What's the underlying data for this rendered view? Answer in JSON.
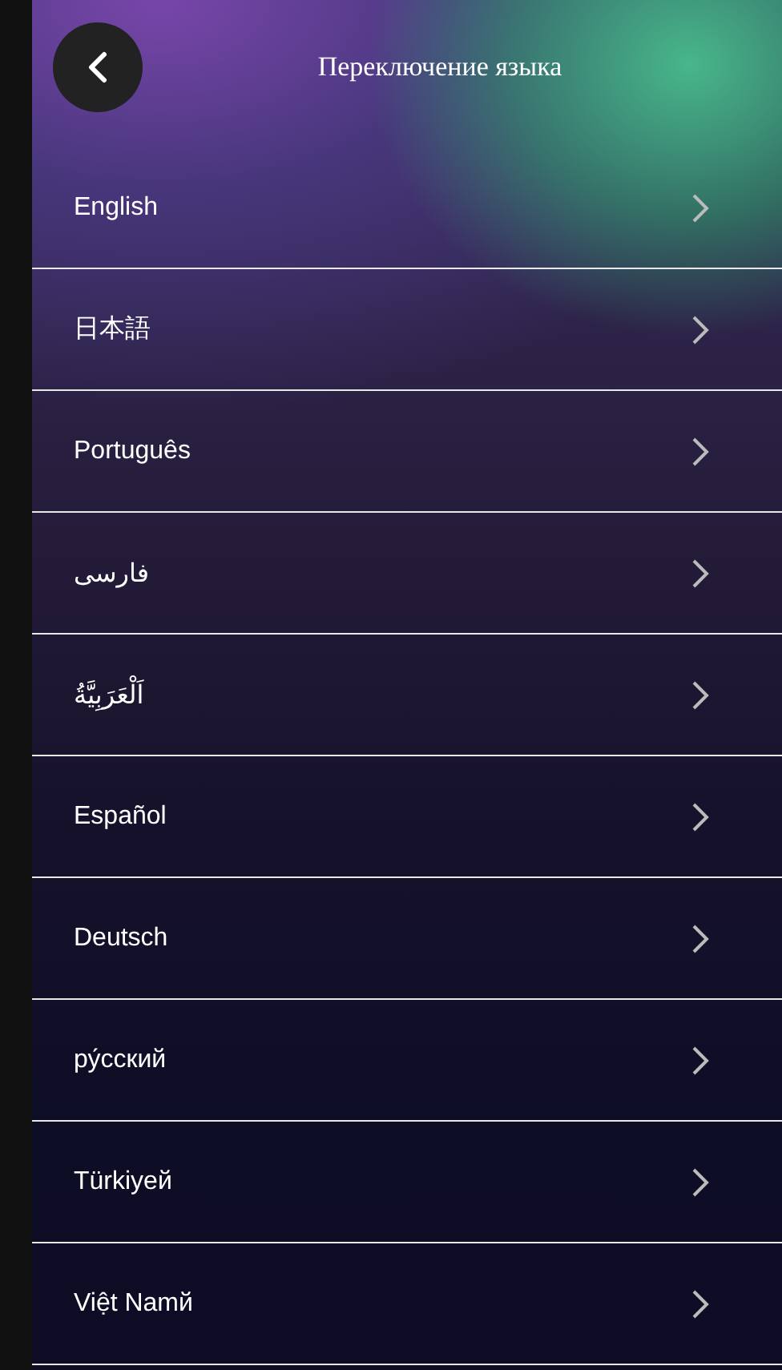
{
  "header": {
    "title": "Переключение языка"
  },
  "languages": [
    {
      "label": "English"
    },
    {
      "label": "日本語"
    },
    {
      "label": "Português"
    },
    {
      "label": "فارسی"
    },
    {
      "label": "اَلْعَرَبِيَّةُ"
    },
    {
      "label": "Español"
    },
    {
      "label": "Deutsch"
    },
    {
      "label": "ру́сский"
    },
    {
      "label": "Türkiyeй"
    },
    {
      "label": "Việt Namй"
    }
  ]
}
